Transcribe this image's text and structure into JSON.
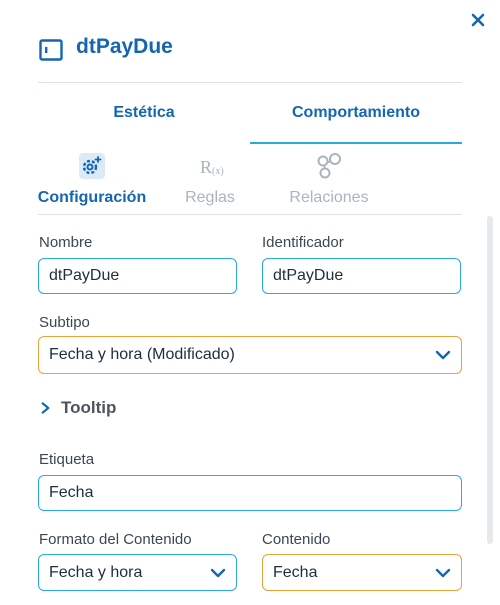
{
  "header": {
    "title": "dtPayDue",
    "icon": "panel-icon",
    "close_icon": "close-icon"
  },
  "tabs": [
    {
      "label": "Estética",
      "active": false
    },
    {
      "label": "Comportamiento",
      "active": true
    }
  ],
  "subtabs": [
    {
      "label": "Configuración",
      "icon": "gear-icon",
      "active": true
    },
    {
      "label": "Reglas",
      "icon": "rules-icon",
      "active": false
    },
    {
      "label": "Relaciones",
      "icon": "relations-icon",
      "active": false
    }
  ],
  "form": {
    "nombre": {
      "label": "Nombre",
      "value": "dtPayDue"
    },
    "identificador": {
      "label": "Identificador",
      "value": "dtPayDue"
    },
    "subtipo": {
      "label": "Subtipo",
      "value": "Fecha y hora (Modificado)"
    },
    "tooltip": {
      "label": "Tooltip"
    },
    "etiqueta": {
      "label": "Etiqueta",
      "value": "Fecha"
    },
    "formato": {
      "label": "Formato del Contenido",
      "value": "Fecha y hora"
    },
    "contenido": {
      "label": "Contenido",
      "value": "Fecha"
    }
  },
  "colors": {
    "accent": "#1566b0",
    "focus_border": "#29abe2",
    "warning_border": "#e8a33a"
  }
}
